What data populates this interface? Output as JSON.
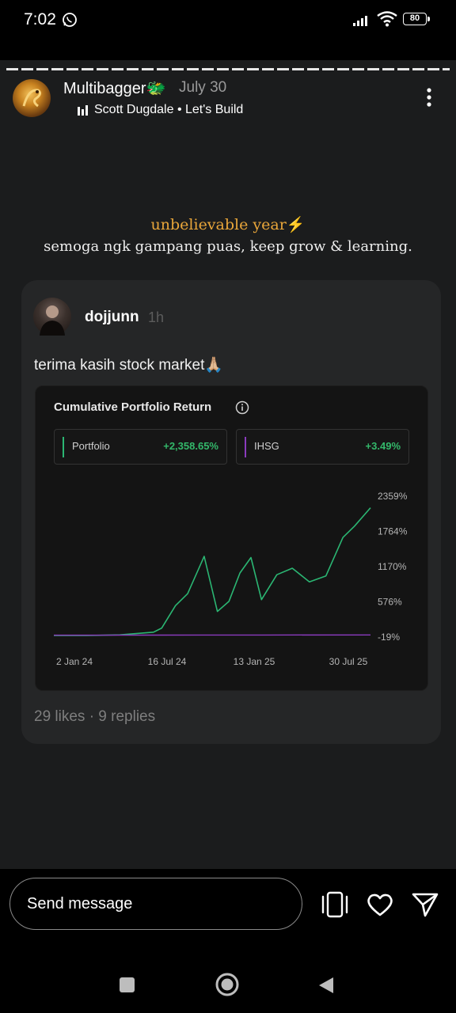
{
  "status_bar": {
    "time": "7:02",
    "battery": "80"
  },
  "story": {
    "username": "Multibagger🐲",
    "date": "July 30",
    "music_label": "Scott Dugdale  •  Let's Build",
    "caption_line1": "unbelievable year⚡",
    "caption_line2": "semoga ngk gampang puas, keep grow & learning."
  },
  "card": {
    "username": "dojjunn",
    "time": "1h",
    "text": "terima kasih stock market🙏🏼",
    "stats": "29 likes · 9 replies"
  },
  "chart_data": {
    "type": "line",
    "title": "Cumulative Portfolio Return",
    "legend": [
      {
        "name": "Portfolio",
        "value": "+2,358.65%",
        "color": "#2bb673"
      },
      {
        "name": "IHSG",
        "value": "+3.49%",
        "color": "#8a3bbd"
      }
    ],
    "y_ticks": [
      "2359%",
      "1764%",
      "1170%",
      "576%",
      "-19%"
    ],
    "x_ticks": [
      "2 Jan 24",
      "16 Jul 24",
      "13 Jan 25",
      "30 Jul 25"
    ],
    "ylim": [
      -19,
      2359
    ],
    "xlim": [
      "2024-01-02",
      "2025-07-30"
    ],
    "series": [
      {
        "name": "Portfolio",
        "x": [
          "2024-01-02",
          "2024-03-01",
          "2024-05-01",
          "2024-07-01",
          "2024-07-16",
          "2024-08-10",
          "2024-09-01",
          "2024-10-01",
          "2024-10-25",
          "2024-11-15",
          "2024-12-05",
          "2024-12-25",
          "2025-01-13",
          "2025-02-10",
          "2025-03-10",
          "2025-04-10",
          "2025-05-10",
          "2025-06-10",
          "2025-07-01",
          "2025-07-30"
        ],
        "values": [
          -5,
          -5,
          5,
          50,
          120,
          500,
          700,
          1330,
          400,
          570,
          1050,
          1310,
          600,
          1020,
          1130,
          900,
          1000,
          1650,
          1840,
          2150
        ]
      },
      {
        "name": "IHSG",
        "x": [
          "2024-01-02",
          "2024-07-16",
          "2025-01-13",
          "2025-07-30"
        ],
        "values": [
          0,
          1,
          3,
          3.49
        ]
      }
    ]
  },
  "bottom": {
    "message_placeholder": "Send message"
  }
}
